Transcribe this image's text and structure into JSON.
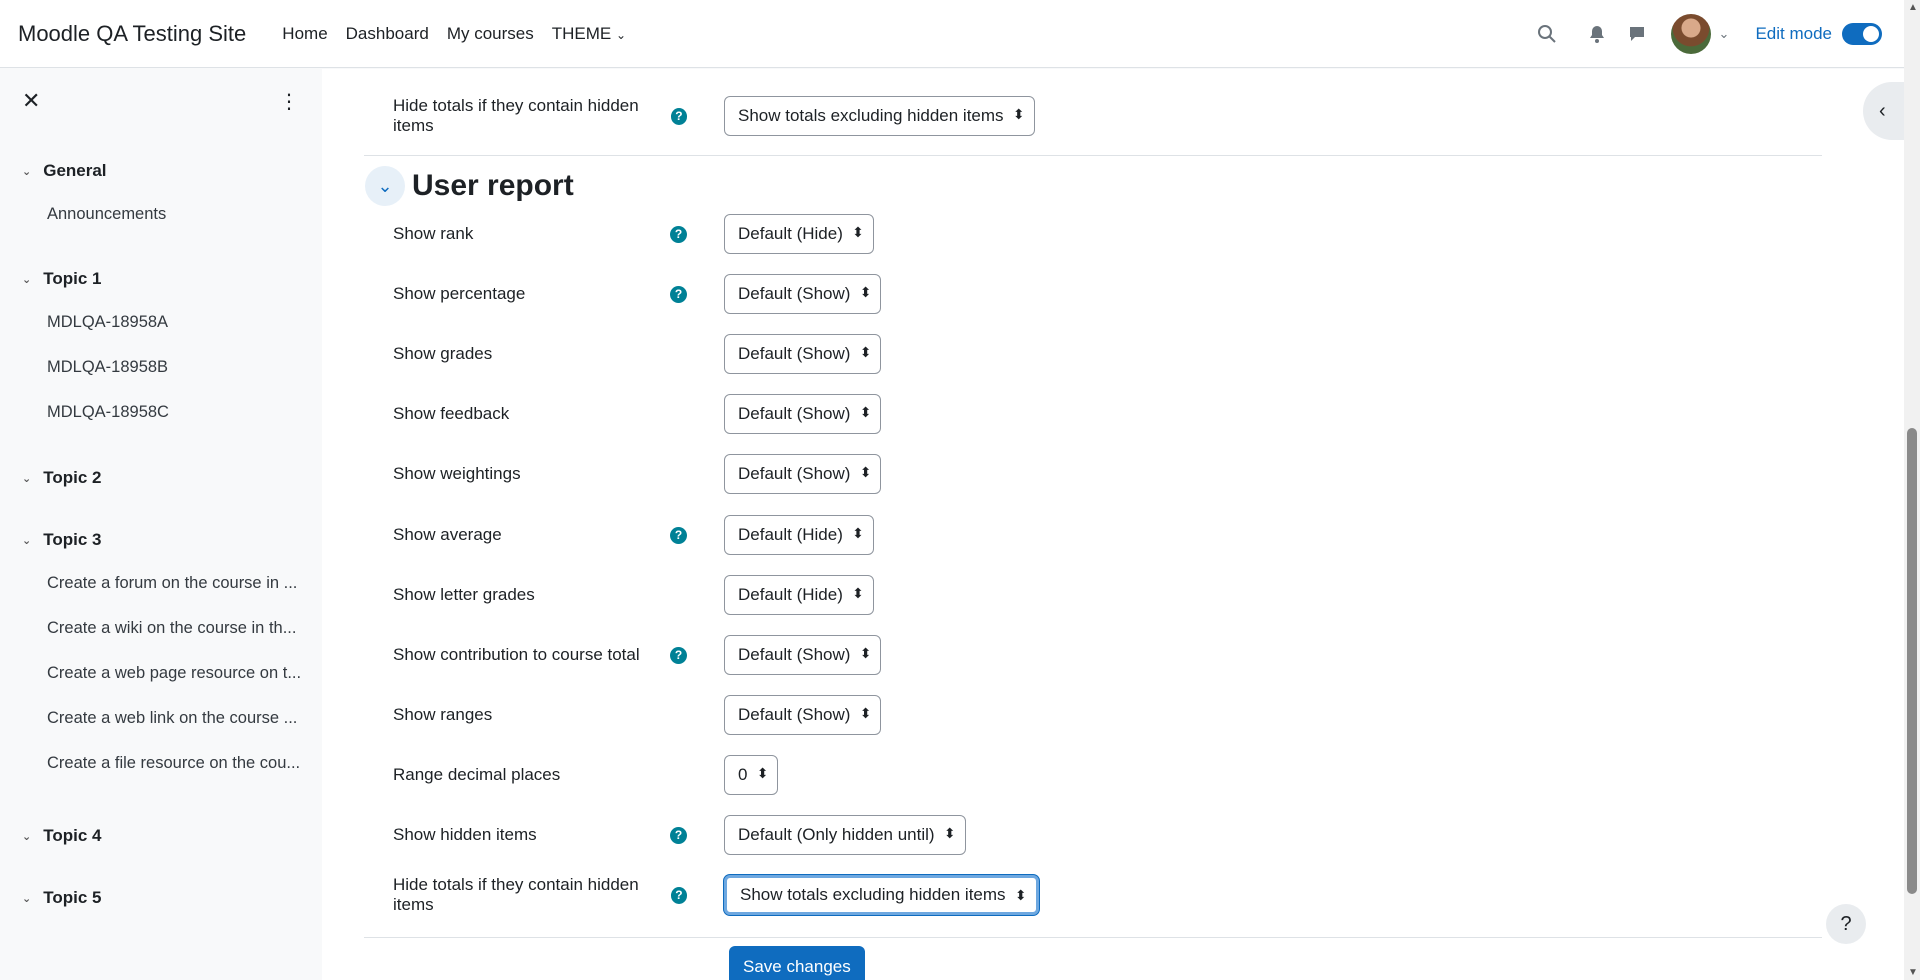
{
  "navbar": {
    "brand": "Moodle QA Testing Site",
    "items": [
      "Home",
      "Dashboard",
      "My courses",
      "THEME"
    ],
    "edit_mode_label": "Edit mode",
    "icons": [
      "search-icon",
      "bell-icon",
      "chat-icon",
      "avatar",
      "chevron-down-icon"
    ]
  },
  "drawer": {
    "sections": [
      {
        "title": "General",
        "items": [
          "Announcements"
        ]
      },
      {
        "title": "Topic 1",
        "items": [
          "MDLQA-18958A",
          "MDLQA-18958B",
          "MDLQA-18958C"
        ]
      },
      {
        "title": "Topic 2",
        "items": []
      },
      {
        "title": "Topic 3",
        "items": [
          "Create a forum on the course in ...",
          "Create a wiki on the course in th...",
          "Create a web page resource on t...",
          "Create a web link on the course ...",
          "Create a file resource on the cou..."
        ]
      },
      {
        "title": "Topic 4",
        "items": []
      },
      {
        "title": "Topic 5",
        "items": []
      }
    ]
  },
  "main": {
    "top_row": {
      "label": "Hide totals if they contain hidden items",
      "value": "Show totals excluding hidden items",
      "help": true
    },
    "section_title": "User report",
    "settings": [
      {
        "label": "Show rank",
        "value": "Default (Hide)",
        "help": true
      },
      {
        "label": "Show percentage",
        "value": "Default (Show)",
        "help": true
      },
      {
        "label": "Show grades",
        "value": "Default (Show)",
        "help": false
      },
      {
        "label": "Show feedback",
        "value": "Default (Show)",
        "help": false
      },
      {
        "label": "Show weightings",
        "value": "Default (Show)",
        "help": false
      },
      {
        "label": "Show average",
        "value": "Default (Hide)",
        "help": true
      },
      {
        "label": "Show letter grades",
        "value": "Default (Hide)",
        "help": false
      },
      {
        "label": "Show contribution to course total",
        "value": "Default (Show)",
        "help": true
      },
      {
        "label": "Show ranges",
        "value": "Default (Show)",
        "help": false
      },
      {
        "label": "Range decimal places",
        "value": "0",
        "help": false
      },
      {
        "label": "Show hidden items",
        "value": "Default (Only hidden until)",
        "help": true
      },
      {
        "label": "Hide totals if they contain hidden items",
        "value": "Show totals excluding hidden items",
        "help": true
      }
    ],
    "save_label": "Save changes",
    "help_float": "?"
  }
}
